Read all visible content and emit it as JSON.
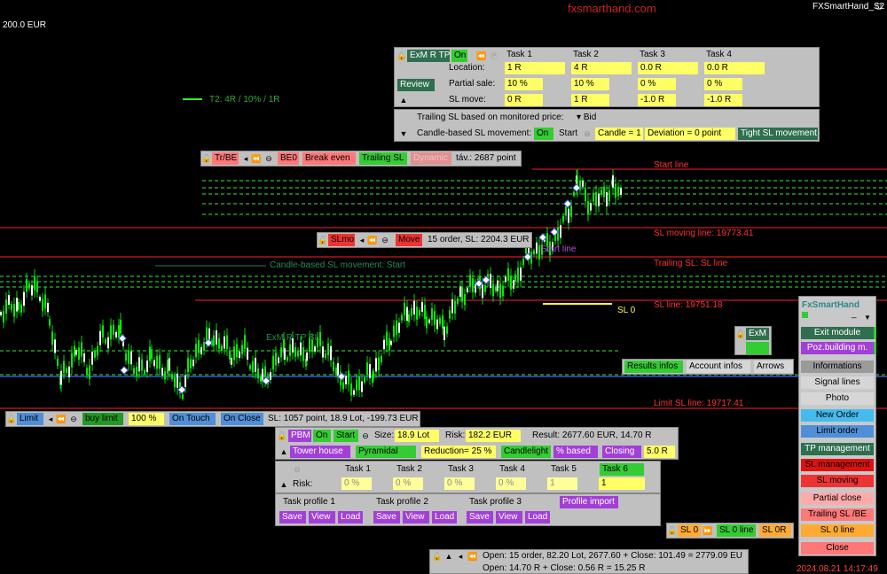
{
  "header": {
    "brand_center": "fxsmarthand.com",
    "brand_right": "FXSmartHand_S2",
    "account_value": "200.0 EUR",
    "timestamp": "2024.08.21 14:17:49"
  },
  "colors": {
    "background": "#000000",
    "candle": "#00ee00",
    "level_red": "#ff2222",
    "level_blue": "#3a5ad8",
    "accent_green": "#33cc33",
    "accent_yellow": "#ffff66"
  },
  "chart_labels": {
    "t2": "T2: 4R / 10% / 1R",
    "start_line": "Start line",
    "sl_moving_line": "SL moving line: 19773.41",
    "start_line2": "Start line",
    "trailing_sl": "Trailing SL: SL line",
    "sl_line": "SL line: 19751.18",
    "sl0": "SL 0",
    "limit_sl": "Limit SL line: 19717.41",
    "candle_sl": "Candle-based SL movement: Start",
    "exm_r_tp": "ExM R TP SL"
  },
  "exm_panel": {
    "title": "ExM R TP",
    "on": "On",
    "review": "Review",
    "tasks": [
      "Task 1",
      "Task 2",
      "Task 3",
      "Task 4"
    ],
    "row_labels": [
      "Location:",
      "Partial sale:",
      "SL move:"
    ],
    "location": [
      "1 R",
      "4 R",
      "0.0 R",
      "0.0 R"
    ],
    "partial": [
      "10 %",
      "10 %",
      "0 %",
      "0 %"
    ],
    "slmove": [
      "0 R",
      "1 R",
      "-1.0 R",
      "-1.0 R"
    ]
  },
  "trailing_panel": {
    "monitored": "Trailing SL based  on monitored price:",
    "price": "Bid",
    "candle_label": "Candle-based SL movement:",
    "on": "On",
    "start": "Start",
    "candle": "Candle = 1",
    "deviation": "Deviation = 0 point",
    "tight": "Tight SL movement"
  },
  "trbe_bar": {
    "trbe": "Tr/BE",
    "be0": "BE0",
    "break_even": "Break even",
    "trailing_sl": "Trailing SL",
    "dynamic": "Dynamic",
    "dist": "táv.: 2687 point"
  },
  "slmo_bar": {
    "slmo": "SLmo",
    "move": "Move",
    "info": "15 order, SL: 2204.3 EUR"
  },
  "limit_bar": {
    "limit": "Limit",
    "buy_limit": "buy limit",
    "pct": "100 %",
    "on_touch": "On Touch",
    "on_close": "On Close",
    "sl": "SL: 1057 point, 18.9 Lot, -199.73 EUR"
  },
  "pbm_panel": {
    "pbm": "PBM",
    "on": "On",
    "start": "Start",
    "size_label": "Size:",
    "size": "18.9 Lot",
    "risk_label": "Risk:",
    "risk": "182.2 EUR",
    "result": "Result: 2677.60 EUR, 14.70 R",
    "tower": "Tower house",
    "pyramidal": "Pyramidal",
    "reduction": "Reduction= 25 %",
    "candlelight": "Candlelight",
    "pct_based": "% based",
    "closing": "Closing",
    "closing_val": "5.0 R"
  },
  "risk_panel": {
    "tasks": [
      "Task 1",
      "Task 2",
      "Task 3",
      "Task 4",
      "Task 5",
      "Task 6"
    ],
    "risk_label": "Risk:",
    "values": [
      "0 %",
      "0 %",
      "0 %",
      "0 %",
      "1",
      "1"
    ]
  },
  "profile_panel": {
    "profiles": [
      "Task profile 1",
      "Task profile 2",
      "Task profile 3"
    ],
    "save": "Save",
    "view": "View",
    "load": "Load",
    "import": "Profile import"
  },
  "exm_mini": {
    "label": "ExM"
  },
  "side_tabs": {
    "results": "Results infos",
    "account": "Account infos",
    "arrows": "Arrows"
  },
  "side_menu": {
    "title": "FxSmartHand",
    "min": "_",
    "exit": "Exit module",
    "poz": "Poz.building m.",
    "info": "Informations",
    "signal": "Signal lines",
    "photo": "Photo",
    "new_order": "New Order",
    "limit_order": "Limit order",
    "tp": "TP management",
    "sl": "SL management",
    "slmov": "SL moving",
    "partial": "Partial close",
    "trailing": "Trailing SL /BE",
    "sl0line": "SL 0 line",
    "close": "Close"
  },
  "sl0_bar": {
    "sl0": "SL 0",
    "sl0line": "SL 0 line",
    "sl0r": "SL 0R"
  },
  "bottom_info": {
    "line1": "Open: 15 order, 82.20 Lot, 2677.60 + Close: 101.49 = 2779.09 EU",
    "line2": "Open: 14.70 R + Close: 0.56 R = 15.25 R"
  }
}
